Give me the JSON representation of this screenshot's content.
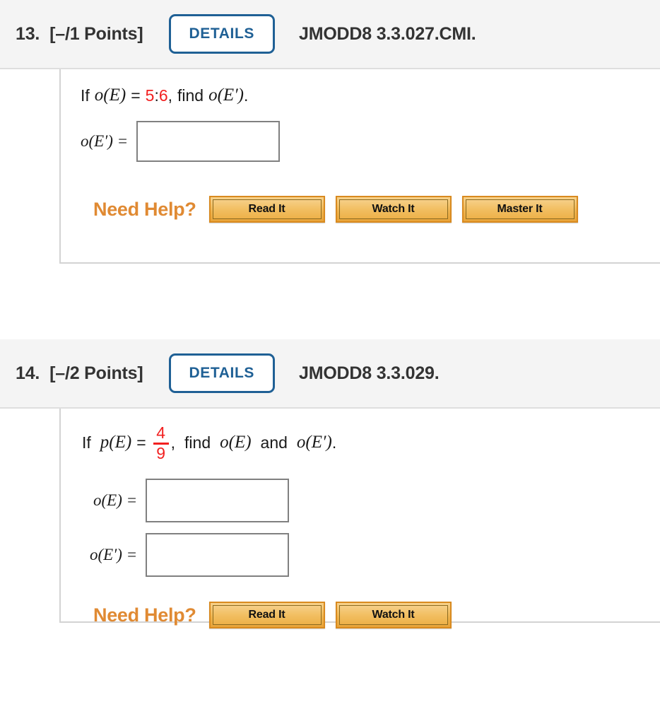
{
  "questions": [
    {
      "number": "13.",
      "points": "[–/1 Points]",
      "details_label": "DETAILS",
      "code": "JMODD8 3.3.027.CMI.",
      "prompt": {
        "lead": "If",
        "func": "o(E)",
        "equals": "=",
        "value_num": "5",
        "value_sep": ":",
        "value_den": "6",
        "comma": ",",
        "find": "find",
        "target": "o(E′)",
        "period": "."
      },
      "answers": [
        {
          "label": "o(E′)  =",
          "value": "",
          "placeholder": ""
        }
      ],
      "need_help": {
        "label": "Need Help?",
        "buttons": [
          "Read It",
          "Watch It",
          "Master It"
        ]
      }
    },
    {
      "number": "14.",
      "points": "[–/2 Points]",
      "details_label": "DETAILS",
      "code": "JMODD8 3.3.029.",
      "prompt": {
        "lead": "If",
        "func": "p(E)",
        "equals": "=",
        "frac_num": "4",
        "frac_den": "9",
        "comma": ",",
        "find": "find",
        "target1": "o(E)",
        "and": "and",
        "target2": "o(E′)",
        "period": "."
      },
      "answers": [
        {
          "label": "o(E)  =",
          "value": "",
          "placeholder": ""
        },
        {
          "label": "o(E′)  =",
          "value": "",
          "placeholder": ""
        }
      ],
      "need_help": {
        "label": "Need Help?",
        "buttons": [
          "Read It",
          "Watch It"
        ]
      }
    }
  ],
  "colors": {
    "accent_blue": "#1f6095",
    "orange": "#e08a33",
    "red": "#f22020",
    "header_bg": "#f4f4f4",
    "border_gray": "#d3d3d3",
    "input_border": "#808080"
  }
}
